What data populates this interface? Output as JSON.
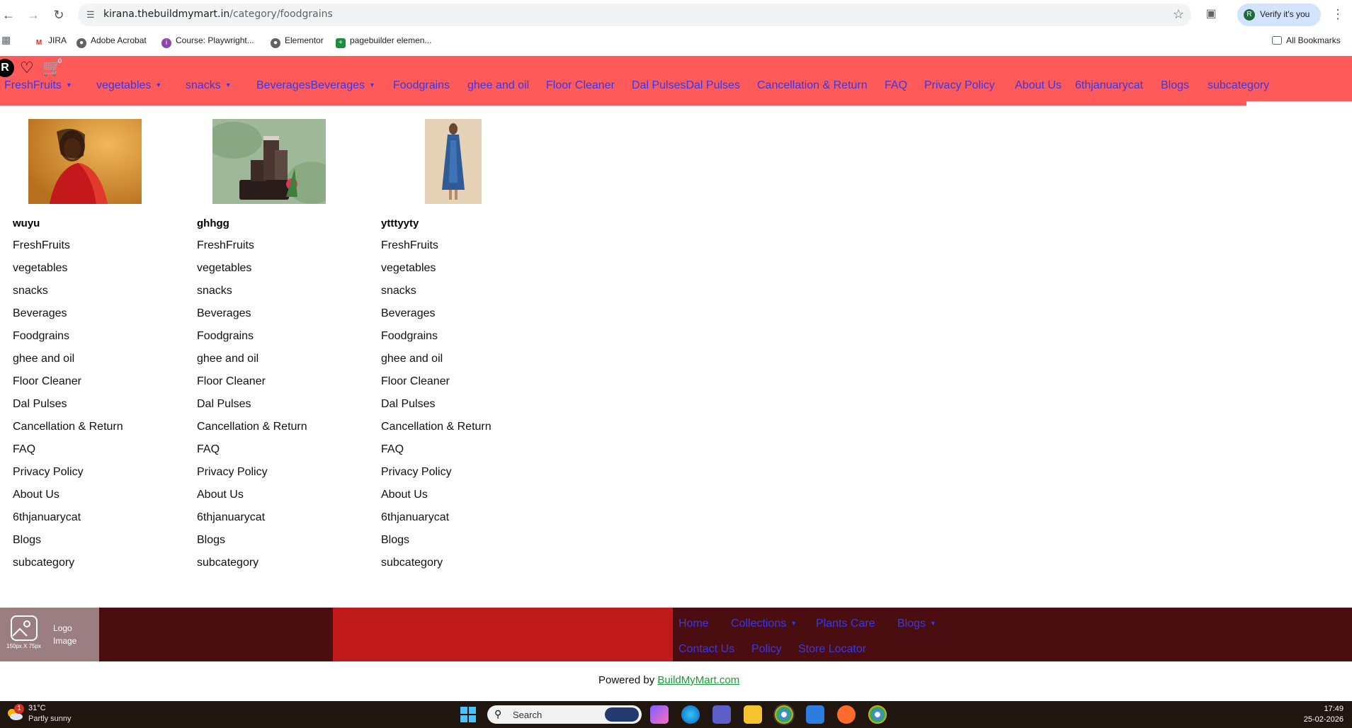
{
  "browser": {
    "url_domain": "kirana.thebuildmymart.in",
    "url_path": "/category/foodgrains",
    "verify_label": "Verify it's you",
    "bookmarks": [
      "JIRA",
      "Adobe Acrobat",
      "Course: Playwright...",
      "Elementor",
      "pagebuilder elemen..."
    ],
    "all_bookmarks": "All Bookmarks"
  },
  "header": {
    "avatar_letter": "R",
    "menu": [
      {
        "label": "FreshFruits",
        "dropdown": true
      },
      {
        "label": "vegetables",
        "dropdown": true
      },
      {
        "label": "snacks",
        "dropdown": true
      },
      {
        "label": "BeveragesBeverages",
        "dropdown": true
      },
      {
        "label": "Foodgrains",
        "dropdown": false
      },
      {
        "label": "ghee and oil",
        "dropdown": false
      },
      {
        "label": "Floor Cleaner",
        "dropdown": false
      },
      {
        "label": "Dal PulsesDal Pulses",
        "dropdown": false
      },
      {
        "label": "Cancellation & Return",
        "dropdown": false
      },
      {
        "label": "FAQ",
        "dropdown": false
      },
      {
        "label": "Privacy Policy",
        "dropdown": false
      },
      {
        "label": "About Us",
        "dropdown": false
      },
      {
        "label": "6thjanuarycat",
        "dropdown": false
      },
      {
        "label": "Blogs",
        "dropdown": false
      },
      {
        "label": "subcategory",
        "dropdown": false
      }
    ]
  },
  "columns": [
    {
      "title": "wuyu",
      "image": "woman-red-saree-photo",
      "links": [
        "FreshFruits",
        "vegetables",
        "snacks",
        "Beverages",
        "Foodgrains",
        "ghee and oil",
        "Floor Cleaner",
        "Dal Pulses",
        "Cancellation & Return",
        "FAQ",
        "Privacy Policy",
        "About Us",
        "6thjanuarycat",
        "Blogs",
        "subcategory"
      ]
    },
    {
      "title": "ghhgg",
      "image": "cosmetic-jars-photo",
      "links": [
        "FreshFruits",
        "vegetables",
        "snacks",
        "Beverages",
        "Foodgrains",
        "ghee and oil",
        "Floor Cleaner",
        "Dal Pulses",
        "Cancellation & Return",
        "FAQ",
        "Privacy Policy",
        "About Us",
        "6thjanuarycat",
        "Blogs",
        "subcategory"
      ]
    },
    {
      "title": "ytttyyty",
      "image": "woman-blue-kurta-photo",
      "links": [
        "FreshFruits",
        "vegetables",
        "snacks",
        "Beverages",
        "Foodgrains",
        "ghee and oil",
        "Floor Cleaner",
        "Dal Pulses",
        "Cancellation & Return",
        "FAQ",
        "Privacy Policy",
        "About Us",
        "6thjanuarycat",
        "Blogs",
        "subcategory"
      ]
    }
  ],
  "footer": {
    "logo_line1": "Logo",
    "logo_line2": "Image",
    "logo_dims": "150px X 75px",
    "links_row1": [
      {
        "label": "Home",
        "dropdown": false
      },
      {
        "label": "Collections",
        "dropdown": true
      },
      {
        "label": "Plants Care",
        "dropdown": false
      },
      {
        "label": "Blogs",
        "dropdown": true
      }
    ],
    "links_row2": [
      {
        "label": "Contact Us",
        "dropdown": false
      },
      {
        "label": "Policy",
        "dropdown": false
      },
      {
        "label": "Store Locator",
        "dropdown": false
      }
    ],
    "powered_prefix": "Powered by",
    "powered_link": "BuildMyMart.com"
  },
  "taskbar": {
    "weather_badge": "1",
    "temperature": "31°C",
    "weather": "Partly sunny",
    "search_label": "Search",
    "time": "17:49",
    "date": "25-02-2026"
  },
  "colors": {
    "header_bg": "#ff5a5a",
    "menu_link": "#3b37e6",
    "footer_dark": "#4a0d10",
    "footer_red": "#c01a1c",
    "powered_link": "#1a9a3a"
  }
}
